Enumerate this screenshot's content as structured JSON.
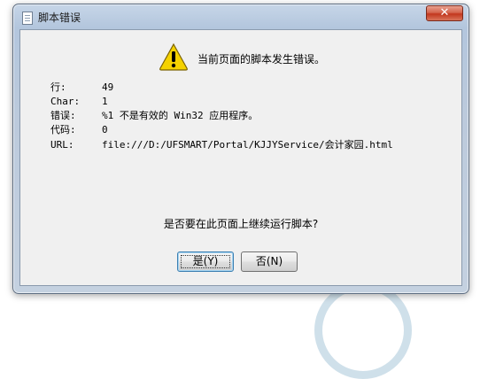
{
  "window": {
    "title": "脚本错误",
    "close_glyph": "✕"
  },
  "message": {
    "headline": "当前页面的脚本发生错误。",
    "icon": "warning-icon"
  },
  "details": [
    {
      "label": "行:",
      "value": "49"
    },
    {
      "label": "Char:",
      "value": "1"
    },
    {
      "label": "错误:",
      "value": "%1 不是有效的 Win32 应用程序。"
    },
    {
      "label": "代码:",
      "value": "0"
    },
    {
      "label": "URL:",
      "value": "file:///D:/UFSMART/Portal/KJJYService/会计家园.html"
    }
  ],
  "prompt": {
    "question": "是否要在此页面上继续运行脚本?"
  },
  "buttons": {
    "yes_label": "是(Y)",
    "no_label": "否(N)"
  },
  "colors": {
    "warning_yellow": "#f5d200",
    "close_red": "#c2371e"
  }
}
